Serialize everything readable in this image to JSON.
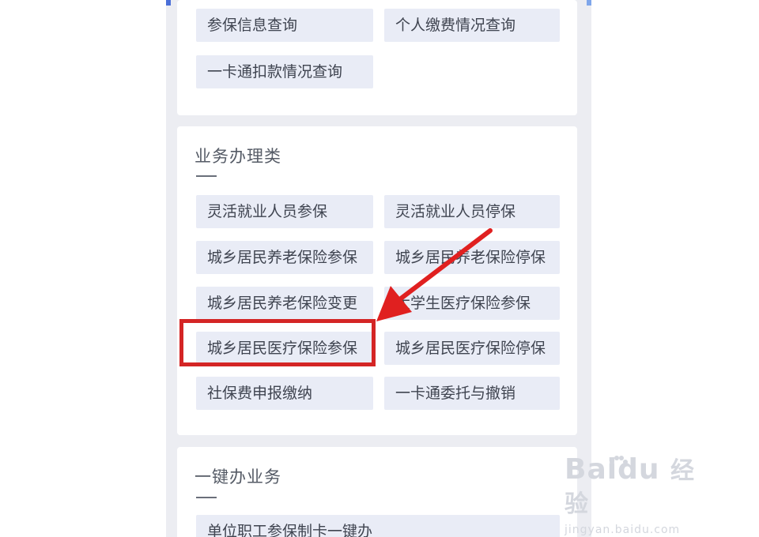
{
  "query_section": {
    "buttons": [
      "参保信息查询",
      "个人缴费情况查询",
      "一卡通扣款情况查询"
    ]
  },
  "business_section": {
    "title": "业务办理类",
    "buttons": [
      "灵活就业人员参保",
      "灵活就业人员停保",
      "城乡居民养老保险参保",
      "城乡居民养老保险停保",
      "城乡居民养老保险变更",
      "大学生医疗保险参保",
      "城乡居民医疗保险参保",
      "城乡居民医疗保险停保",
      "社保费申报缴纳",
      "一卡通委托与撤销"
    ]
  },
  "one_click_section": {
    "title": "一键办业务",
    "buttons": [
      "单位职工参保制卡一键办"
    ]
  },
  "annotation": {
    "highlight_color": "#d42525",
    "highlighted_item": "城乡居民医疗保险参保"
  },
  "watermark": {
    "brand_a": "Bai",
    "brand_b": "du",
    "product": "经验",
    "url": "jingyan.baidu.com"
  }
}
